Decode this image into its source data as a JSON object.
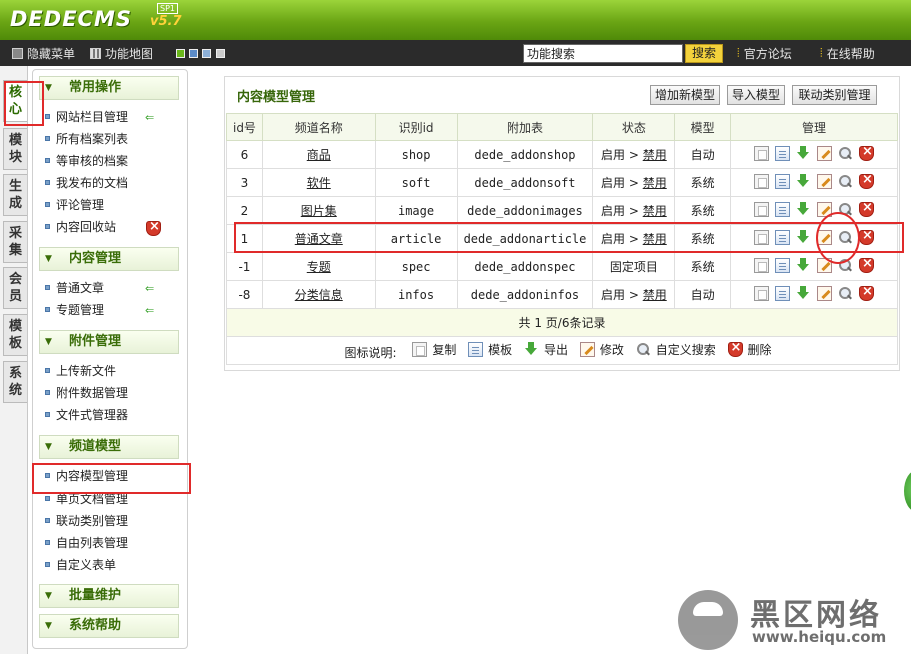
{
  "brand": {
    "logo": "DEDECMS",
    "version": "v5.7",
    "sp": "SP1"
  },
  "topbar": {
    "hide_menu": "隐藏菜单",
    "site_map": "功能地图",
    "search_value": "功能搜索",
    "search_button": "搜索",
    "forum": "官方论坛",
    "help": "在线帮助",
    "skins": [
      "#6ab71a",
      "#5b8bc8",
      "#8db0d8",
      "#cccccc"
    ]
  },
  "vtabs": [
    {
      "label": "核心"
    },
    {
      "label": "模块"
    },
    {
      "label": "生成"
    },
    {
      "label": "采集"
    },
    {
      "label": "会员"
    },
    {
      "label": "模板"
    },
    {
      "label": "系统"
    }
  ],
  "menu": {
    "sections": [
      {
        "title": "常用操作",
        "items": [
          "网站栏目管理",
          "所有档案列表",
          "等审核的档案",
          "我发布的文档",
          "评论管理",
          "内容回收站"
        ]
      },
      {
        "title": "内容管理",
        "items": [
          "普通文章",
          "专题管理"
        ]
      },
      {
        "title": "附件管理",
        "items": [
          "上传新文件",
          "附件数据管理",
          "文件式管理器"
        ]
      },
      {
        "title": "频道模型",
        "items": [
          "内容模型管理",
          "单页文档管理",
          "联动类别管理",
          "自由列表管理",
          "自定义表单"
        ]
      },
      {
        "title": "批量维护",
        "items": []
      },
      {
        "title": "系统帮助",
        "items": []
      }
    ]
  },
  "panel": {
    "title": "内容模型管理",
    "btn_add": "增加新模型",
    "btn_import": "导入模型",
    "btn_linkage": "联动类别管理",
    "headers": [
      "id号",
      "频道名称",
      "识别id",
      "附加表",
      "状态",
      "模型",
      "管理"
    ],
    "rows": [
      {
        "id": "6",
        "name": "商品",
        "nid": "shop",
        "table": "dede_addonshop",
        "status": "启用",
        "status_sep": ">",
        "status_action": "禁用",
        "model": "自动"
      },
      {
        "id": "3",
        "name": "软件",
        "nid": "soft",
        "table": "dede_addonsoft",
        "status": "启用",
        "status_sep": ">",
        "status_action": "禁用",
        "model": "系统"
      },
      {
        "id": "2",
        "name": "图片集",
        "nid": "image",
        "table": "dede_addonimages",
        "status": "启用",
        "status_sep": ">",
        "status_action": "禁用",
        "model": "系统"
      },
      {
        "id": "1",
        "name": "普通文章",
        "nid": "article",
        "table": "dede_addonarticle",
        "status": "启用",
        "status_sep": ">",
        "status_action": "禁用",
        "model": "系统"
      },
      {
        "id": "-1",
        "name": "专题",
        "nid": "spec",
        "table": "dede_addonspec",
        "status": "固定项目",
        "status_sep": "",
        "status_action": "",
        "model": "系统"
      },
      {
        "id": "-8",
        "name": "分类信息",
        "nid": "infos",
        "table": "dede_addoninfos",
        "status": "启用",
        "status_sep": ">",
        "status_action": "禁用",
        "model": "自动"
      }
    ],
    "pagination": "共 1 页/6条记录",
    "legend_label": "图标说明:",
    "legend": [
      "复制",
      "模板",
      "导出",
      "修改",
      "自定义搜索",
      "删除"
    ]
  },
  "watermark": {
    "text": "黑区网络",
    "url": "www.heiqu.com"
  }
}
